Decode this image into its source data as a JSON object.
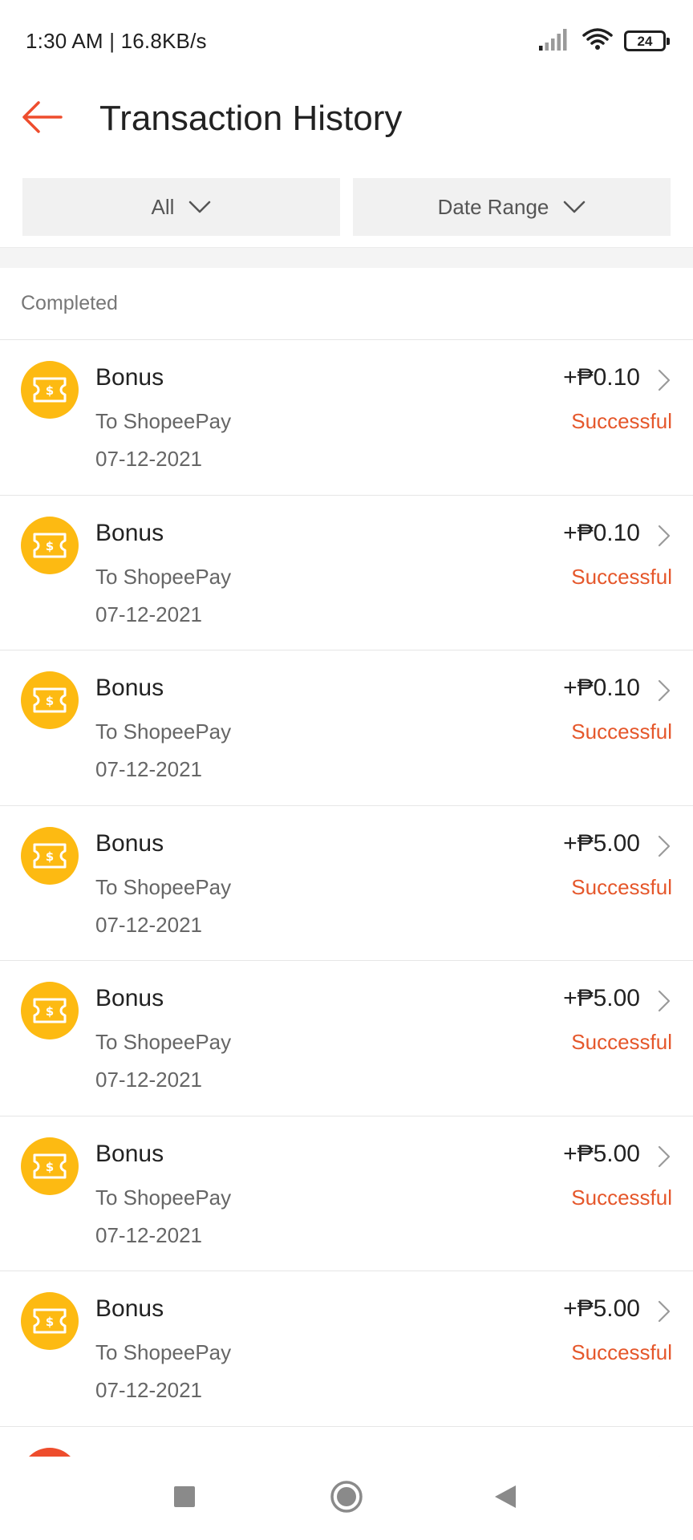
{
  "status_bar": {
    "time_speed": "1:30 AM | 16.8KB/s",
    "battery": "24"
  },
  "header": {
    "title": "Transaction History"
  },
  "filters": {
    "type_label": "All",
    "date_label": "Date Range"
  },
  "section": {
    "label": "Completed"
  },
  "transactions": [
    {
      "title": "Bonus",
      "subtitle": "To ShopeePay",
      "date": "07-12-2021",
      "amount": "+₱0.10",
      "status": "Successful"
    },
    {
      "title": "Bonus",
      "subtitle": "To ShopeePay",
      "date": "07-12-2021",
      "amount": "+₱0.10",
      "status": "Successful"
    },
    {
      "title": "Bonus",
      "subtitle": "To ShopeePay",
      "date": "07-12-2021",
      "amount": "+₱0.10",
      "status": "Successful"
    },
    {
      "title": "Bonus",
      "subtitle": "To ShopeePay",
      "date": "07-12-2021",
      "amount": "+₱5.00",
      "status": "Successful"
    },
    {
      "title": "Bonus",
      "subtitle": "To ShopeePay",
      "date": "07-12-2021",
      "amount": "+₱5.00",
      "status": "Successful"
    },
    {
      "title": "Bonus",
      "subtitle": "To ShopeePay",
      "date": "07-12-2021",
      "amount": "+₱5.00",
      "status": "Successful"
    },
    {
      "title": "Bonus",
      "subtitle": "To ShopeePay",
      "date": "07-12-2021",
      "amount": "+₱5.00",
      "status": "Successful"
    }
  ],
  "colors": {
    "accent": "#ee4d2d",
    "status_success": "#e5572b",
    "bonus_icon_bg": "#fdba12"
  },
  "icons": {
    "back": "arrow-left-icon",
    "filter_chevron": "chevron-down-icon",
    "row_chevron": "chevron-right-icon",
    "bonus": "ticket-dollar-icon"
  }
}
